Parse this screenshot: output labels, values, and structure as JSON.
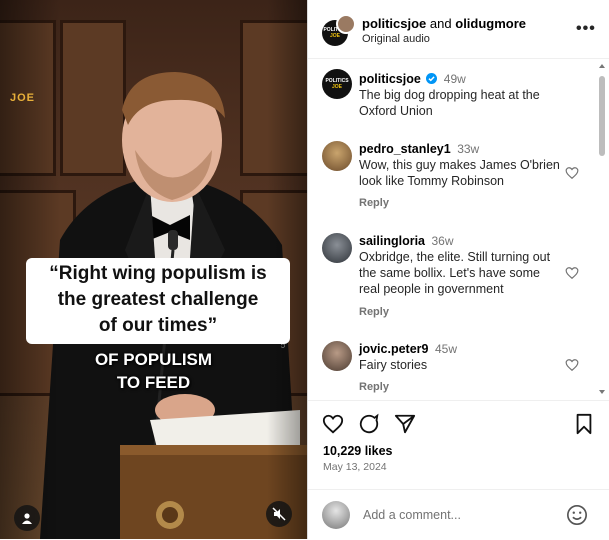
{
  "video": {
    "watermark": "JOE",
    "quote_lines": [
      "“Right wing populism is",
      "the greatest challenge",
      "of our times”"
    ],
    "overlay_lines": [
      "OF POPULISM",
      "TO FEED"
    ],
    "side_mark": "Oxford Union"
  },
  "header": {
    "user1": "politicsjoe",
    "conjunction": "and",
    "user2": "olidugmore",
    "subtitle": "Original audio",
    "more": "•••"
  },
  "avatar_logo": {
    "line1": "POLITICS",
    "line2": "JOE"
  },
  "caption": {
    "username": "politicsjoe",
    "time": "49w",
    "text": "The big dog dropping heat at the Oxford Union"
  },
  "comments": [
    {
      "username": "pedro_stanley1",
      "time": "33w",
      "text": "Wow, this guy makes James O'brien look like Tommy Robinson",
      "reply": "Reply"
    },
    {
      "username": "sailingloria",
      "time": "36w",
      "text": "Oxbridge, the elite. Still turning out the same bollix. Let's have some real people in government",
      "reply": "Reply"
    },
    {
      "username": "jovic.peter9",
      "time": "45w",
      "text": "Fairy stories",
      "reply": "Reply"
    }
  ],
  "post": {
    "likes": "10,229 likes",
    "date": "May 13, 2024"
  },
  "add_comment": {
    "placeholder": "Add a comment..."
  },
  "colors": {
    "verified": "#0095f6",
    "accent_gold": "#f1c40f"
  }
}
